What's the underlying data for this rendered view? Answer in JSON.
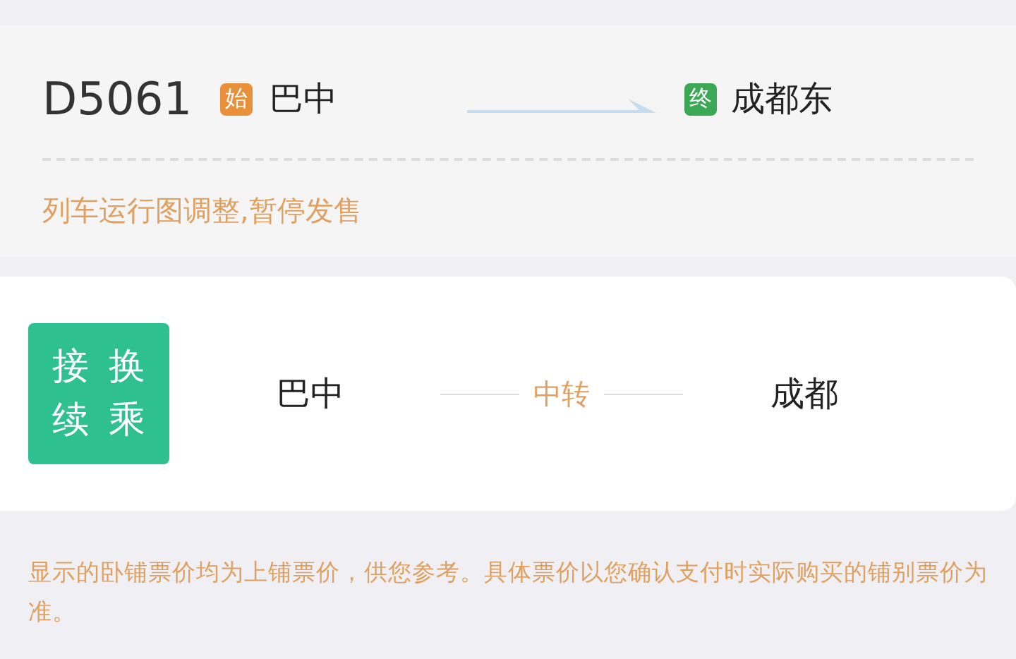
{
  "train": {
    "number": "D5061",
    "origin": {
      "badge": "始",
      "name": "巴中"
    },
    "destination": {
      "badge": "终",
      "name": "成都东"
    },
    "notice": "列车运行图调整,暂停发售"
  },
  "transfer": {
    "badge_lines": [
      "接换",
      "续乘"
    ],
    "from": "巴中",
    "via": "中转",
    "to": "成都"
  },
  "footnote": "显示的卧铺票价均为上铺票价，供您参考。具体票价以您确认支付时实际购买的铺别票价为准。"
}
